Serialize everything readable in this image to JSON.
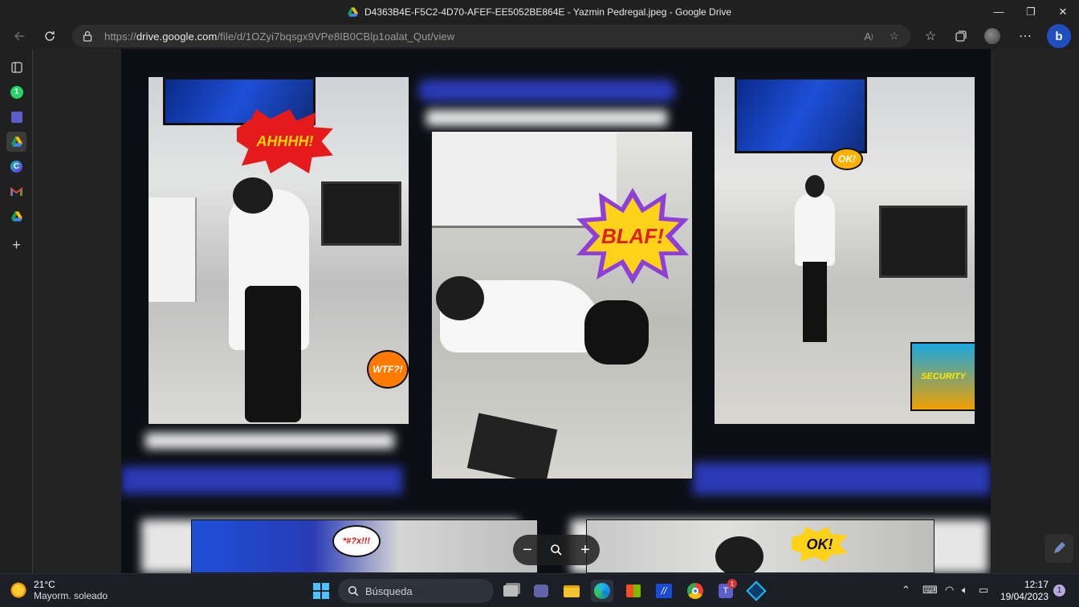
{
  "window": {
    "title": "D4363B4E-F5C2-4D70-AFEF-EE5052BE864E - Yazmin Pedregal.jpeg - Google Drive",
    "minimize": "—",
    "maximize": "❐",
    "close": "✕"
  },
  "address_bar": {
    "url_prefix": "https://",
    "url_host": "drive.google.com",
    "url_path": "/file/d/1OZyi7bqsgx9VPe8IB0CBlp1oalat_Qut/view"
  },
  "photo": {
    "panels": [
      {
        "caption_burst": "AHHHH!",
        "small_burst": "WTF?!"
      },
      {
        "caption_burst": "BLAF!"
      },
      {
        "caption_burst": "OK!",
        "small_burst": "SECURITY"
      },
      {
        "caption_burst": "*#?x!!!"
      },
      {
        "caption_burst": "OK!"
      }
    ]
  },
  "zoom": {
    "minus": "−",
    "plus": "+"
  },
  "taskbar": {
    "weather_temp": "21°C",
    "weather_desc": "Mayorm. soleado",
    "search_label": "Búsqueda",
    "teams_badge": "1",
    "time": "12:17",
    "date": "19/04/2023",
    "notification_count": "1"
  },
  "colors": {
    "chrome_bg": "#202020",
    "viewer_bg": "#232323",
    "accent_blue": "#2a3bb5",
    "taskbar_bg": "#1c1f26"
  }
}
